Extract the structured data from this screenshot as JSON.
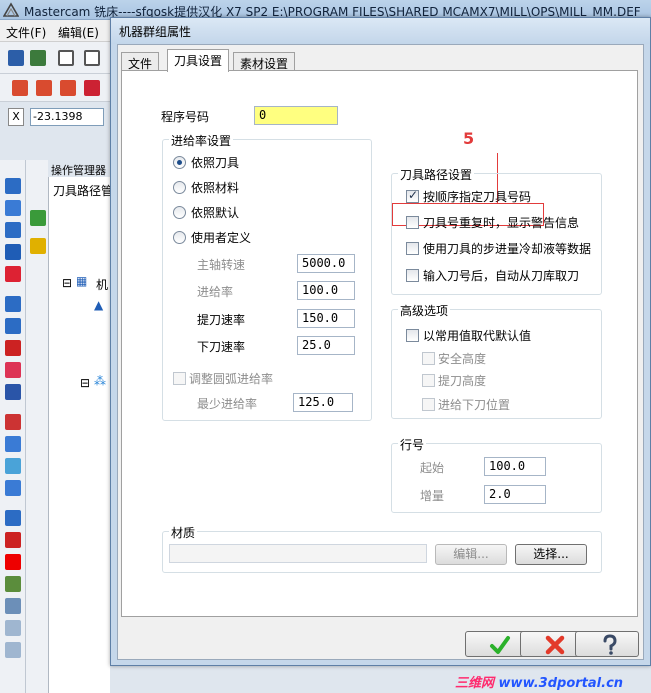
{
  "app": {
    "title": "Mastercam 铣床----sfqosk提供汉化 X7 SP2   E:\\PROGRAM FILES\\SHARED MCAMX7\\MILL\\OPS\\MILL_MM.DEF",
    "menu": [
      "文件(F)",
      "编辑(E)"
    ],
    "coord_axis": "X",
    "coord_value": "-23.1398",
    "opmgr_title": "操作管理器",
    "opmgr_tab": "刀具路径管",
    "tree_root": "机"
  },
  "dialog": {
    "title": "机器群组属性",
    "tabs": [
      "文件",
      "刀具设置",
      "素材设置"
    ],
    "active_tab": 1,
    "annotation_number": "5",
    "program_number": {
      "label": "程序号码",
      "value": "0"
    },
    "feed": {
      "title": "进给率设置",
      "options": [
        "依照刀具",
        "依照材料",
        "依照默认",
        "使用者定义"
      ],
      "selected": 0,
      "fields": [
        {
          "label": "主轴转速",
          "value": "5000.0",
          "disabled": true
        },
        {
          "label": "进给率",
          "value": "100.0",
          "disabled": true
        },
        {
          "label": "提刀速率",
          "value": "150.0",
          "disabled": false
        },
        {
          "label": "下刀速率",
          "value": "25.0",
          "disabled": false
        }
      ],
      "arc_adjust": {
        "label": "调整圆弧进给率",
        "checked": false
      },
      "min_feed": {
        "label": "最少进给率",
        "value": "125.0"
      }
    },
    "toolpath": {
      "title": "刀具路径设置",
      "items": [
        {
          "label": "按顺序指定刀具号码",
          "checked": true
        },
        {
          "label": "刀具号重复时，显示警告信息",
          "checked": false
        },
        {
          "label": "使用刀具的步进量冷却液等数据",
          "checked": false
        },
        {
          "label": "输入刀号后，自动从刀库取刀",
          "checked": false
        }
      ]
    },
    "advanced": {
      "title": "高级选项",
      "main": {
        "label": "以常用值取代默认值",
        "checked": false
      },
      "subs": [
        "安全高度",
        "提刀高度",
        "进给下刀位置"
      ]
    },
    "line_number": {
      "title": "行号",
      "start": {
        "label": "起始",
        "value": "100.0"
      },
      "increment": {
        "label": "增量",
        "value": "2.0"
      }
    },
    "material": {
      "title": "材质",
      "value": "",
      "edit_label": "编辑...",
      "select_label": "选择..."
    },
    "colors": {
      "ok": "#2bb12b",
      "cancel": "#e33a2a",
      "help": "#3a4a66",
      "highlight": "#ffff80"
    }
  },
  "watermark": {
    "cn": "三维网",
    "url": "www.3dportal.cn"
  }
}
